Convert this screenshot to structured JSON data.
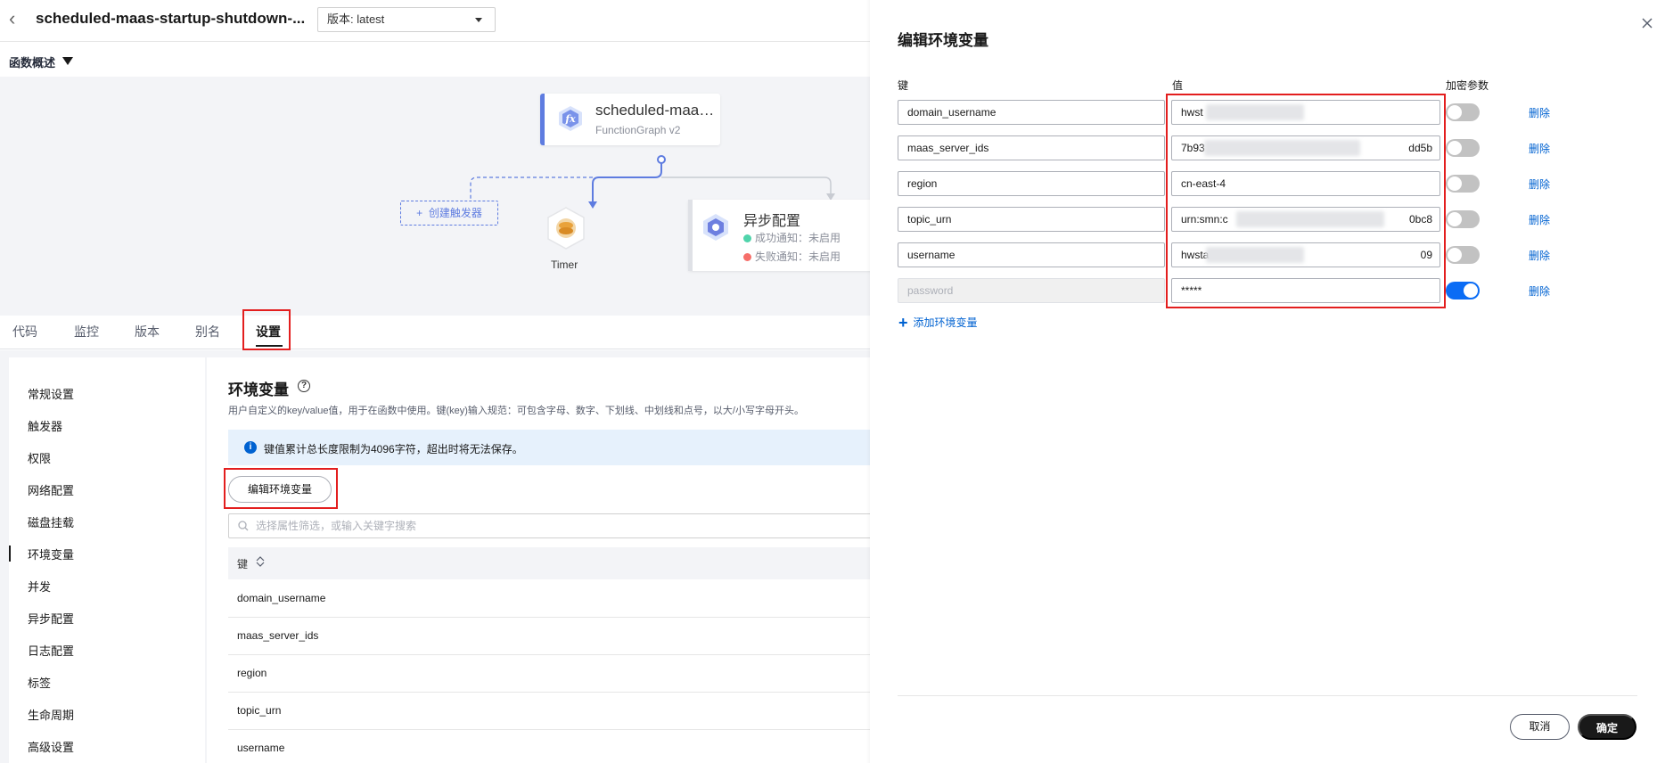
{
  "header": {
    "title": "scheduled-maas-startup-shutdown-...",
    "version_label": "版本: latest"
  },
  "overview": {
    "label": "函数概述"
  },
  "diagram": {
    "function_name": "scheduled-maas...",
    "function_type": "FunctionGraph v2",
    "create_trigger": "创建触发器",
    "timer_label": "Timer",
    "async": {
      "title": "异步配置",
      "success": "成功通知：未启用",
      "failure": "失败通知：未启用"
    }
  },
  "tabs": [
    {
      "label": "代码"
    },
    {
      "label": "监控"
    },
    {
      "label": "版本"
    },
    {
      "label": "别名"
    },
    {
      "label": "设置"
    }
  ],
  "side_nav": [
    {
      "label": "常规设置"
    },
    {
      "label": "触发器"
    },
    {
      "label": "权限"
    },
    {
      "label": "网络配置"
    },
    {
      "label": "磁盘挂载"
    },
    {
      "label": "环境变量"
    },
    {
      "label": "并发"
    },
    {
      "label": "异步配置"
    },
    {
      "label": "日志配置"
    },
    {
      "label": "标签"
    },
    {
      "label": "生命周期"
    },
    {
      "label": "高级设置"
    }
  ],
  "env_section": {
    "title": "环境变量",
    "description": "用户自定义的key/value值，用于在函数中使用。键(key)输入规范：可包含字母、数字、下划线、中划线和点号，以大/小写字母开头。",
    "info": "键值累计总长度限制为4096字符，超出时将无法保存。",
    "edit_button": "编辑环境变量",
    "search_placeholder": "选择属性筛选，或输入关键字搜索",
    "col_key": "键",
    "rows": [
      "domain_username",
      "maas_server_ids",
      "region",
      "topic_urn",
      "username"
    ]
  },
  "drawer": {
    "title": "编辑环境变量",
    "col_key": "键",
    "col_value": "值",
    "col_encrypt": "加密参数",
    "delete_label": "删除",
    "add_label": "添加环境变量",
    "cancel_label": "取消",
    "confirm_label": "确定",
    "vars": [
      {
        "key": "domain_username",
        "value_start": "hwst",
        "value_end": "",
        "encrypted": false,
        "disabled": false
      },
      {
        "key": "maas_server_ids",
        "value_start": "7b93",
        "value_end": "dd5b",
        "encrypted": false,
        "disabled": false
      },
      {
        "key": "region",
        "value_start": "cn-east-4",
        "value_end": "",
        "encrypted": false,
        "disabled": false
      },
      {
        "key": "topic_urn",
        "value_start": "urn:smn:c",
        "value_end": "0bc8",
        "encrypted": false,
        "disabled": false
      },
      {
        "key": "username",
        "value_start": "hwsta",
        "value_end": "09",
        "encrypted": false,
        "disabled": false
      },
      {
        "key": "password",
        "value_start": "*****",
        "value_end": "",
        "encrypted": true,
        "disabled": true
      }
    ]
  },
  "colors": {
    "accent_blue": "#0062d1",
    "toggle_on": "#0a6cf5",
    "highlight_red": "#e31e1e",
    "primary_button": "#191919"
  }
}
